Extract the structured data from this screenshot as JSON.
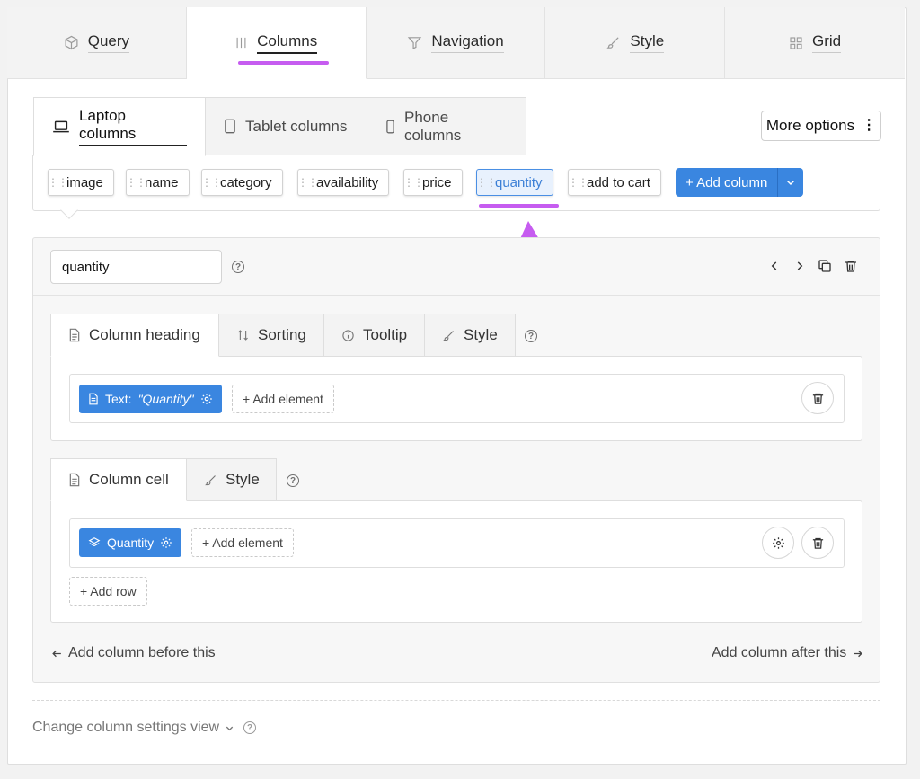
{
  "top_tabs": [
    {
      "label": "Query",
      "icon": "cube-icon"
    },
    {
      "label": "Columns",
      "icon": "columns-icon"
    },
    {
      "label": "Navigation",
      "icon": "filter-icon"
    },
    {
      "label": "Style",
      "icon": "brush-icon"
    },
    {
      "label": "Grid",
      "icon": "grid-icon"
    }
  ],
  "active_top_tab": "Columns",
  "device_tabs": [
    {
      "label": "Laptop columns",
      "icon": "laptop-icon"
    },
    {
      "label": "Tablet columns",
      "icon": "tablet-icon"
    },
    {
      "label": "Phone columns",
      "icon": "phone-icon"
    }
  ],
  "more_options_label": "More options",
  "columns": [
    "image",
    "name",
    "category",
    "availability",
    "price",
    "quantity",
    "add to cart"
  ],
  "selected_column": "quantity",
  "add_column_label": "+ Add column",
  "column_name_value": "quantity",
  "heading_tabs": [
    {
      "label": "Column heading",
      "icon": "document-icon"
    },
    {
      "label": "Sorting",
      "icon": "sort-icon"
    },
    {
      "label": "Tooltip",
      "icon": "info-icon"
    },
    {
      "label": "Style",
      "icon": "brush-icon"
    }
  ],
  "heading_element": {
    "prefix": "Text:",
    "value": "\"Quantity\""
  },
  "add_element_label": "+ Add element",
  "cell_tabs": [
    {
      "label": "Column cell",
      "icon": "document-icon"
    },
    {
      "label": "Style",
      "icon": "brush-icon"
    }
  ],
  "cell_element_label": "Quantity",
  "add_row_label": "+ Add row",
  "add_before_label": "Add column before this",
  "add_after_label": "Add column after this",
  "footer_label": "Change column settings view",
  "colors": {
    "accent": "#3a86e0",
    "highlight": "#c65cf0"
  }
}
